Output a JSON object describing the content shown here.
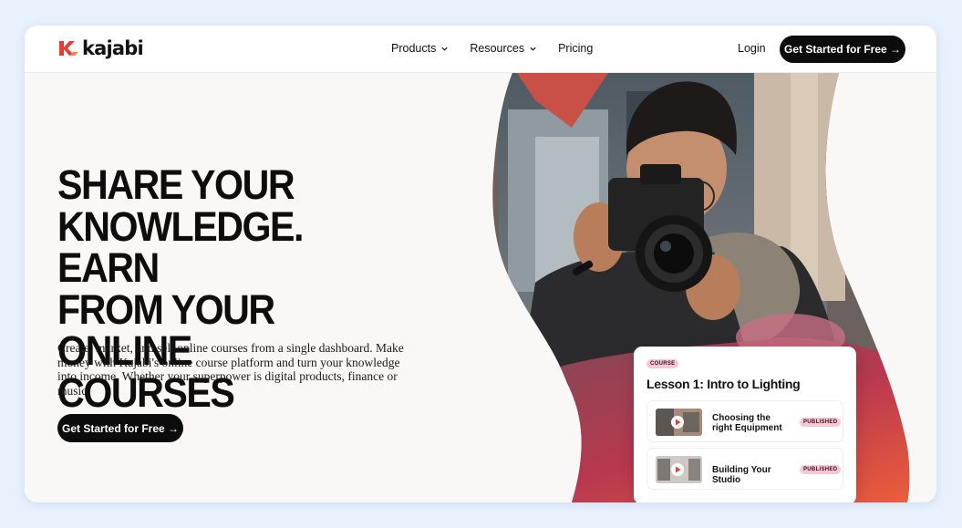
{
  "brand": {
    "name": "kajabi",
    "accent": "#e83a3a"
  },
  "nav": {
    "items": [
      {
        "label": "Products",
        "has_dropdown": true
      },
      {
        "label": "Resources",
        "has_dropdown": true
      },
      {
        "label": "Pricing",
        "has_dropdown": false
      }
    ],
    "login": "Login",
    "cta": "Get Started for Free →"
  },
  "hero": {
    "title_lines": [
      "SHARE YOUR",
      "KNOWLEDGE. EARN",
      "FROM YOUR ONLINE",
      "COURSES"
    ],
    "subtitle": "Create, market, and sell online courses from a single dashboard. Make money with Kajabi's online course platform and turn your knowledge into income. Whether your superpower is digital products, finance or music.",
    "cta": "Get Started for Free →"
  },
  "course_card": {
    "badge": "COURSE",
    "title": "Lesson 1: Intro to Lighting",
    "lessons": [
      {
        "name": "Choosing the right Equipment",
        "status": "PUBLISHED"
      },
      {
        "name": "Building Your Studio",
        "status": "PUBLISHED"
      }
    ]
  }
}
